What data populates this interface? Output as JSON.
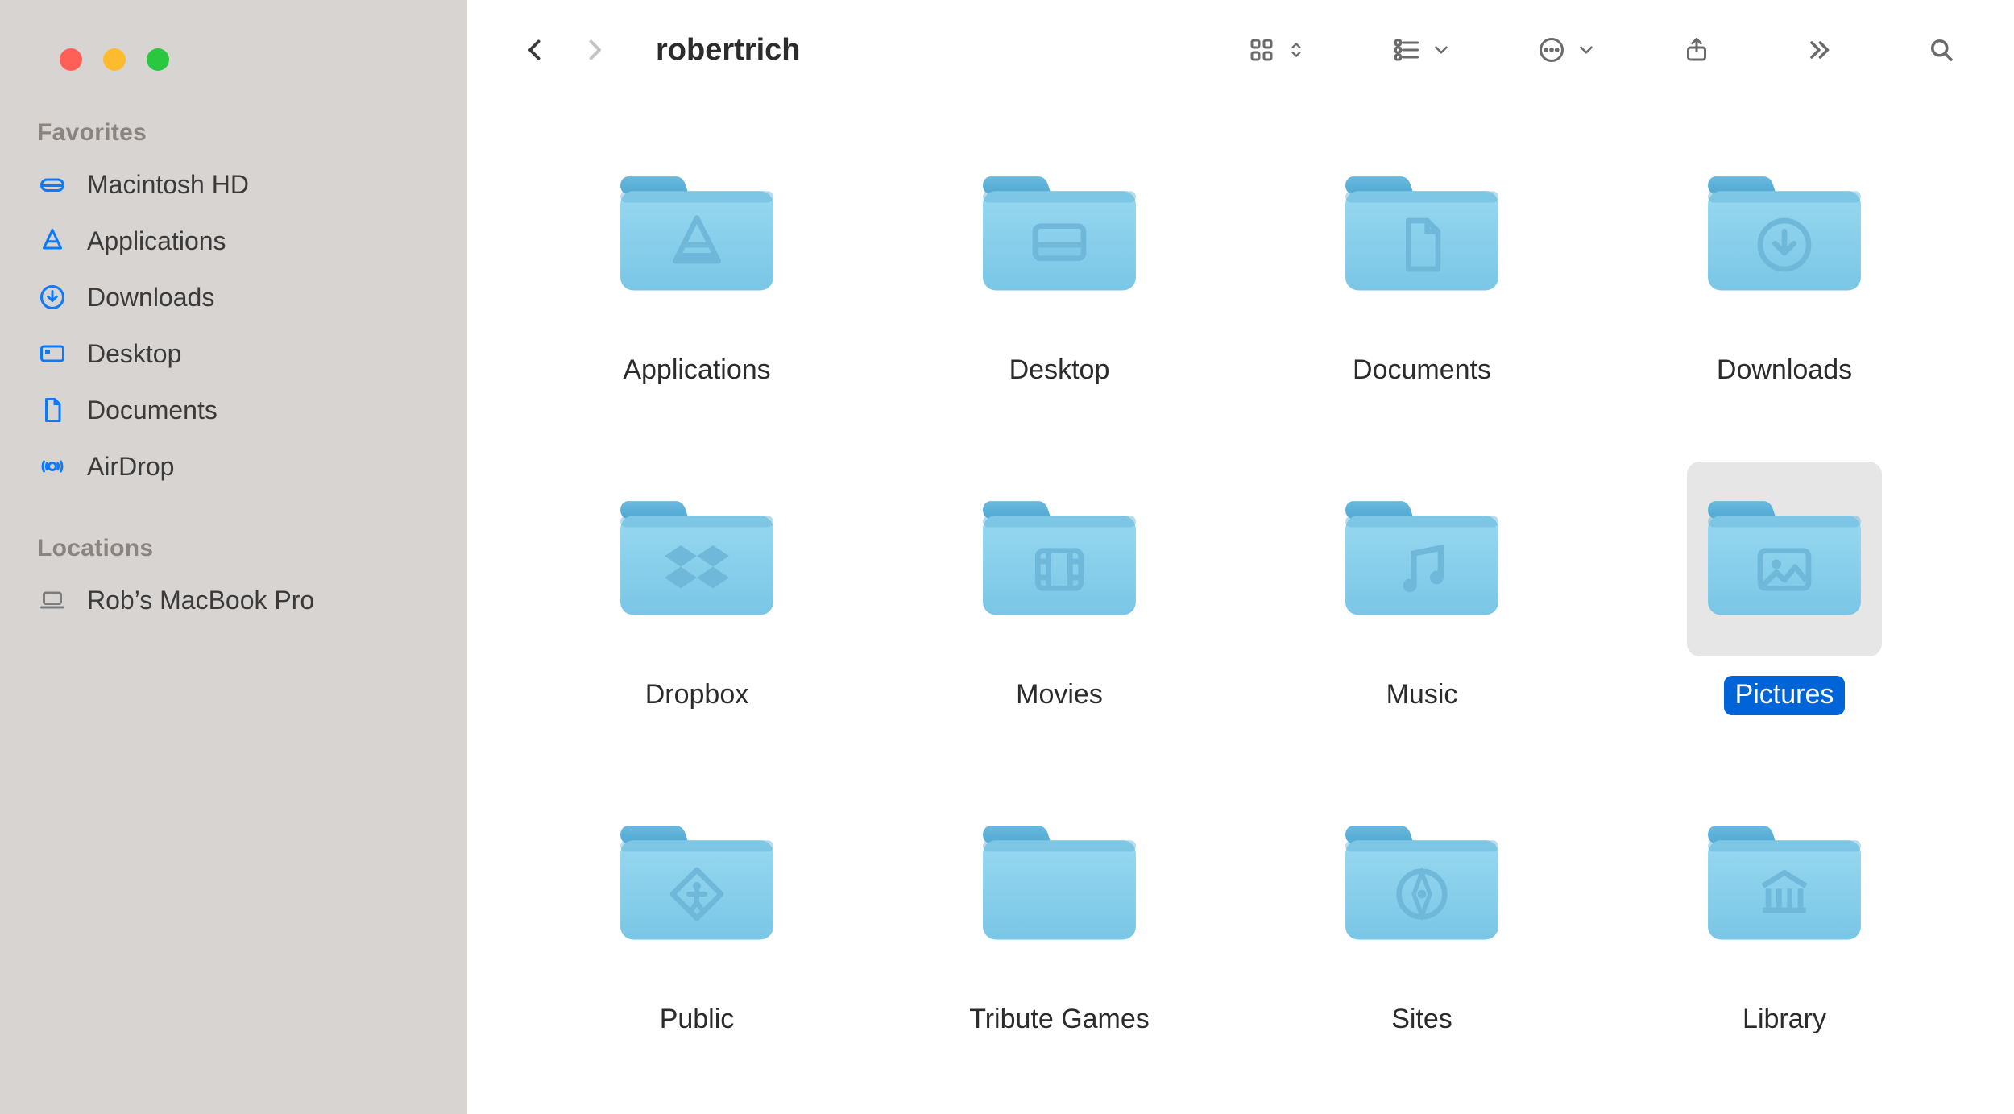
{
  "window": {
    "title": "robertrich"
  },
  "sidebar": {
    "favorites_label": "Favorites",
    "favorites": [
      {
        "label": "Macintosh HD",
        "icon": "hdd-icon"
      },
      {
        "label": "Applications",
        "icon": "apps-icon"
      },
      {
        "label": "Downloads",
        "icon": "download-circle-icon"
      },
      {
        "label": "Desktop",
        "icon": "desktop-icon"
      },
      {
        "label": "Documents",
        "icon": "document-icon"
      },
      {
        "label": "AirDrop",
        "icon": "airdrop-icon"
      }
    ],
    "locations_label": "Locations",
    "locations": [
      {
        "label": "Rob’s MacBook Pro",
        "icon": "laptop-icon"
      }
    ]
  },
  "folders": [
    {
      "label": "Applications",
      "glyph": "apps",
      "selected": false
    },
    {
      "label": "Desktop",
      "glyph": "desktop",
      "selected": false
    },
    {
      "label": "Documents",
      "glyph": "document",
      "selected": false
    },
    {
      "label": "Downloads",
      "glyph": "download",
      "selected": false
    },
    {
      "label": "Dropbox",
      "glyph": "dropbox",
      "selected": false
    },
    {
      "label": "Movies",
      "glyph": "movie",
      "selected": false
    },
    {
      "label": "Music",
      "glyph": "music",
      "selected": false
    },
    {
      "label": "Pictures",
      "glyph": "picture",
      "selected": true
    },
    {
      "label": "Public",
      "glyph": "public",
      "selected": false
    },
    {
      "label": "Tribute Games",
      "glyph": "generic",
      "selected": false
    },
    {
      "label": "Sites",
      "glyph": "sites",
      "selected": false
    },
    {
      "label": "Library",
      "glyph": "library",
      "selected": false
    }
  ],
  "colors": {
    "folder_light": "#8bd2ee",
    "folder_mid": "#77c3e4",
    "folder_dark": "#4ea7d2",
    "sidebar_accent": "#0a7bff",
    "selection_bg": "#e6e6e6",
    "selection_label": "#0064d9"
  }
}
